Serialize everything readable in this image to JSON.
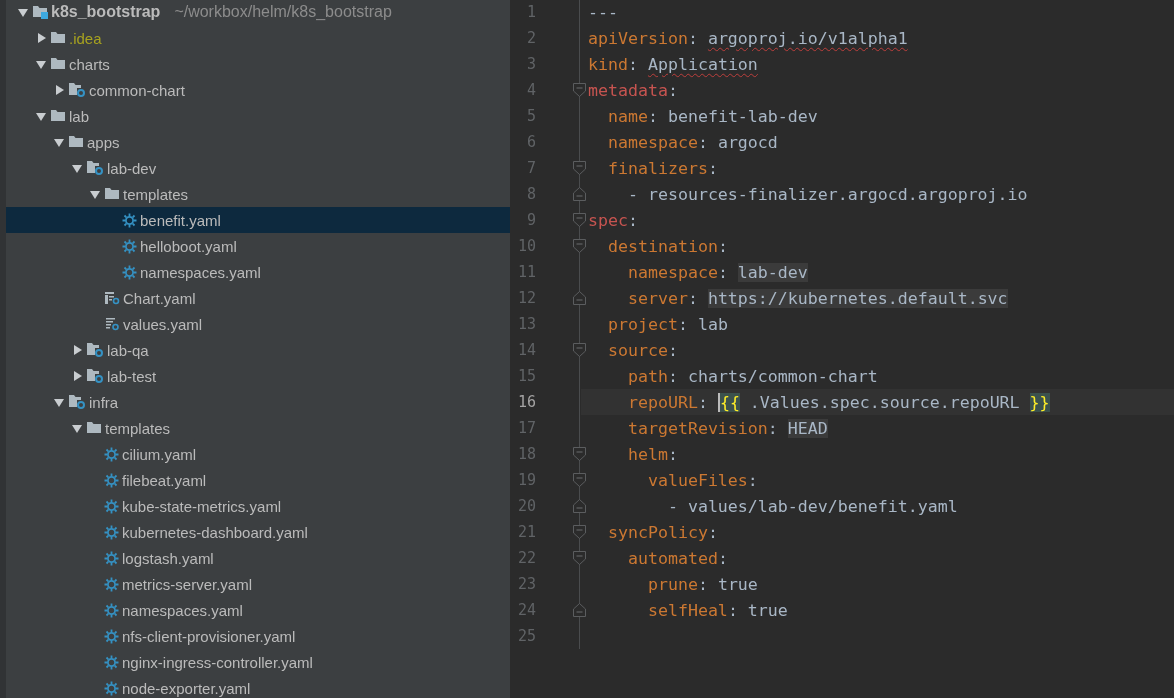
{
  "project_tree": [
    {
      "kind": "project",
      "name": "k8s_bootstrap",
      "path": "~/workbox/helm/k8s_bootstrap",
      "expanded": true,
      "selected": false,
      "children": [
        {
          "kind": "ignored-folder",
          "name": ".idea",
          "expanded": false,
          "selected": false
        },
        {
          "kind": "folder",
          "name": "charts",
          "expanded": true,
          "selected": false,
          "children": [
            {
              "kind": "module",
              "name": "common-chart",
              "expanded": false,
              "selected": false
            }
          ]
        },
        {
          "kind": "folder",
          "name": "lab",
          "expanded": true,
          "selected": false,
          "children": [
            {
              "kind": "folder",
              "name": "apps",
              "expanded": true,
              "selected": false,
              "children": [
                {
                  "kind": "module",
                  "name": "lab-dev",
                  "expanded": true,
                  "selected": false,
                  "children": [
                    {
                      "kind": "folder",
                      "name": "templates",
                      "expanded": true,
                      "selected": false,
                      "children": [
                        {
                          "kind": "yaml",
                          "name": "benefit.yaml",
                          "selected": true
                        },
                        {
                          "kind": "yaml",
                          "name": "helloboot.yaml",
                          "selected": false
                        },
                        {
                          "kind": "yaml",
                          "name": "namespaces.yaml",
                          "selected": false
                        }
                      ]
                    },
                    {
                      "kind": "chart",
                      "name": "Chart.yaml",
                      "selected": false
                    },
                    {
                      "kind": "values",
                      "name": "values.yaml",
                      "selected": false
                    }
                  ]
                },
                {
                  "kind": "module",
                  "name": "lab-qa",
                  "expanded": false,
                  "selected": false
                },
                {
                  "kind": "module",
                  "name": "lab-test",
                  "expanded": false,
                  "selected": false
                }
              ]
            },
            {
              "kind": "module",
              "name": "infra",
              "expanded": true,
              "selected": false,
              "children": [
                {
                  "kind": "folder",
                  "name": "templates",
                  "expanded": true,
                  "selected": false,
                  "children": [
                    {
                      "kind": "yaml",
                      "name": "cilium.yaml",
                      "selected": false
                    },
                    {
                      "kind": "yaml",
                      "name": "filebeat.yaml",
                      "selected": false
                    },
                    {
                      "kind": "yaml",
                      "name": "kube-state-metrics.yaml",
                      "selected": false
                    },
                    {
                      "kind": "yaml",
                      "name": "kubernetes-dashboard.yaml",
                      "selected": false
                    },
                    {
                      "kind": "yaml",
                      "name": "logstash.yaml",
                      "selected": false
                    },
                    {
                      "kind": "yaml",
                      "name": "metrics-server.yaml",
                      "selected": false
                    },
                    {
                      "kind": "yaml",
                      "name": "namespaces.yaml",
                      "selected": false
                    },
                    {
                      "kind": "yaml",
                      "name": "nfs-client-provisioner.yaml",
                      "selected": false
                    },
                    {
                      "kind": "yaml",
                      "name": "nginx-ingress-controller.yaml",
                      "selected": false
                    },
                    {
                      "kind": "yaml",
                      "name": "node-exporter.yaml",
                      "selected": false
                    }
                  ]
                }
              ]
            }
          ]
        }
      ]
    }
  ],
  "editor": {
    "lines": [
      {
        "number": "1",
        "kind": "plain",
        "current": false,
        "tokens": [
          {
            "kind": "punct",
            "text": "---"
          }
        ]
      },
      {
        "number": "2",
        "kind": "plain",
        "current": false,
        "tokens": [
          {
            "kind": "key",
            "text": "apiVersion"
          },
          {
            "kind": "punct",
            "text": ": "
          },
          {
            "kind": "typo",
            "text": "argoproj.io/v1alpha1"
          }
        ]
      },
      {
        "number": "3",
        "kind": "plain",
        "current": false,
        "tokens": [
          {
            "kind": "key",
            "text": "kind"
          },
          {
            "kind": "punct",
            "text": ": "
          },
          {
            "kind": "typo",
            "text": "Application"
          }
        ]
      },
      {
        "number": "4",
        "kind": "fold-start",
        "current": false,
        "tokens": [
          {
            "kind": "root-key",
            "text": "metadata"
          },
          {
            "kind": "punct",
            "text": ":"
          }
        ]
      },
      {
        "number": "5",
        "kind": "plain",
        "current": false,
        "tokens": [
          {
            "kind": "key",
            "text": "  name"
          },
          {
            "kind": "punct",
            "text": ": "
          },
          {
            "kind": "value",
            "text": "benefit-lab-dev"
          }
        ]
      },
      {
        "number": "6",
        "kind": "plain",
        "current": false,
        "tokens": [
          {
            "kind": "key",
            "text": "  namespace"
          },
          {
            "kind": "punct",
            "text": ": "
          },
          {
            "kind": "value",
            "text": "argocd"
          }
        ]
      },
      {
        "number": "7",
        "kind": "fold-start",
        "current": false,
        "tokens": [
          {
            "kind": "key",
            "text": "  finalizers"
          },
          {
            "kind": "punct",
            "text": ":"
          }
        ]
      },
      {
        "number": "8",
        "kind": "fold-end",
        "current": false,
        "tokens": [
          {
            "kind": "value",
            "text": "    - resources-finalizer.argocd.argoproj.io"
          }
        ]
      },
      {
        "number": "9",
        "kind": "fold-start",
        "current": false,
        "tokens": [
          {
            "kind": "root-key",
            "text": "spec"
          },
          {
            "kind": "punct",
            "text": ":"
          }
        ]
      },
      {
        "number": "10",
        "kind": "fold-start",
        "current": false,
        "tokens": [
          {
            "kind": "key",
            "text": "  destination"
          },
          {
            "kind": "punct",
            "text": ":"
          }
        ]
      },
      {
        "number": "11",
        "kind": "plain",
        "current": false,
        "tokens": [
          {
            "kind": "key",
            "text": "    namespace"
          },
          {
            "kind": "punct",
            "text": ": "
          },
          {
            "kind": "boxed",
            "text": "lab-dev"
          }
        ]
      },
      {
        "number": "12",
        "kind": "fold-end",
        "current": false,
        "tokens": [
          {
            "kind": "key",
            "text": "    server"
          },
          {
            "kind": "punct",
            "text": ": "
          },
          {
            "kind": "boxed",
            "text": "https://kubernetes.default.svc"
          }
        ]
      },
      {
        "number": "13",
        "kind": "plain",
        "current": false,
        "tokens": [
          {
            "kind": "key",
            "text": "  project"
          },
          {
            "kind": "punct",
            "text": ": "
          },
          {
            "kind": "value",
            "text": "lab"
          }
        ]
      },
      {
        "number": "14",
        "kind": "fold-start",
        "current": false,
        "tokens": [
          {
            "kind": "key",
            "text": "  source"
          },
          {
            "kind": "punct",
            "text": ":"
          }
        ]
      },
      {
        "number": "15",
        "kind": "plain",
        "current": false,
        "tokens": [
          {
            "kind": "key",
            "text": "    path"
          },
          {
            "kind": "punct",
            "text": ": "
          },
          {
            "kind": "value",
            "text": "charts/common-chart"
          }
        ]
      },
      {
        "number": "16",
        "kind": "plain",
        "current": true,
        "tokens": [
          {
            "kind": "key",
            "text": "    repoURL"
          },
          {
            "kind": "punct",
            "text": ": "
          },
          {
            "kind": "brace-at-caret",
            "text": "{{"
          },
          {
            "kind": "value",
            "text": " .Values.spec.source.repoURL "
          },
          {
            "kind": "brace",
            "text": "}}"
          }
        ]
      },
      {
        "number": "17",
        "kind": "plain",
        "current": false,
        "tokens": [
          {
            "kind": "key",
            "text": "    targetRevision"
          },
          {
            "kind": "punct",
            "text": ": "
          },
          {
            "kind": "boxed",
            "text": "HEAD"
          }
        ]
      },
      {
        "number": "18",
        "kind": "fold-start",
        "current": false,
        "tokens": [
          {
            "kind": "key",
            "text": "    helm"
          },
          {
            "kind": "punct",
            "text": ":"
          }
        ]
      },
      {
        "number": "19",
        "kind": "fold-start",
        "current": false,
        "tokens": [
          {
            "kind": "key",
            "text": "      valueFiles"
          },
          {
            "kind": "punct",
            "text": ":"
          }
        ]
      },
      {
        "number": "20",
        "kind": "fold-end",
        "current": false,
        "tokens": [
          {
            "kind": "value",
            "text": "        - values/lab-dev/benefit.yaml"
          }
        ]
      },
      {
        "number": "21",
        "kind": "fold-start",
        "current": false,
        "tokens": [
          {
            "kind": "key",
            "text": "  syncPolicy"
          },
          {
            "kind": "punct",
            "text": ":"
          }
        ]
      },
      {
        "number": "22",
        "kind": "fold-start",
        "current": false,
        "tokens": [
          {
            "kind": "key",
            "text": "    automated"
          },
          {
            "kind": "punct",
            "text": ":"
          }
        ]
      },
      {
        "number": "23",
        "kind": "plain",
        "current": false,
        "tokens": [
          {
            "kind": "key",
            "text": "      prune"
          },
          {
            "kind": "punct",
            "text": ": "
          },
          {
            "kind": "value",
            "text": "true"
          }
        ]
      },
      {
        "number": "24",
        "kind": "fold-end",
        "current": false,
        "tokens": [
          {
            "kind": "key",
            "text": "      selfHeal"
          },
          {
            "kind": "punct",
            "text": ": "
          },
          {
            "kind": "value",
            "text": "true"
          }
        ]
      },
      {
        "number": "25",
        "kind": "plain",
        "current": false
      }
    ]
  }
}
